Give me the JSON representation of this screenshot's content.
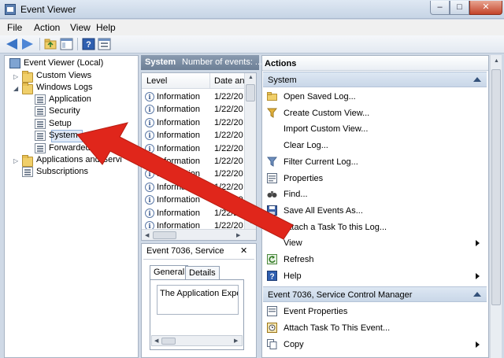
{
  "window": {
    "title": "Event Viewer",
    "controls": {
      "minimize": "–",
      "maximize": "□",
      "close": "✕"
    }
  },
  "menu": [
    "File",
    "Action",
    "View",
    "Help"
  ],
  "toolbar": {
    "icons": [
      "back-arrow-icon",
      "forward-arrow-icon",
      "folder-up-icon",
      "show-hide-tree-icon",
      "help-icon",
      "properties-icon"
    ]
  },
  "tree": {
    "root": "Event Viewer (Local)",
    "custom_views": "Custom Views",
    "windows_logs": "Windows Logs",
    "logs": [
      "Application",
      "Security",
      "Setup",
      "System",
      "Forwarded"
    ],
    "apps_services": "Applications and Servi",
    "subscriptions": "Subscriptions",
    "selected": "System"
  },
  "middle": {
    "header_title": "System",
    "header_count": "Number of events: ...",
    "columns": {
      "level": "Level",
      "date": "Date and"
    },
    "rows": [
      {
        "level": "Information",
        "date": "1/22/20"
      },
      {
        "level": "Information",
        "date": "1/22/20"
      },
      {
        "level": "Information",
        "date": "1/22/20"
      },
      {
        "level": "Information",
        "date": "1/22/20"
      },
      {
        "level": "Information",
        "date": "1/22/20"
      },
      {
        "level": "Information",
        "date": "1/22/20"
      },
      {
        "level": "Information",
        "date": "1/22/20"
      },
      {
        "level": "Information",
        "date": "1/22/20"
      },
      {
        "level": "Information",
        "date": "1/22/20"
      },
      {
        "level": "Information",
        "date": "1/22/20"
      },
      {
        "level": "Information",
        "date": "1/22/20"
      }
    ],
    "detail": {
      "title": "Event 7036, Service",
      "close": "✕",
      "tabs": [
        "General",
        "Details"
      ],
      "text": "The Application Expe"
    }
  },
  "actions": {
    "header": "Actions",
    "sections": [
      {
        "title": "System",
        "items": [
          {
            "label": "Open Saved Log...",
            "icon": "open-folder-icon"
          },
          {
            "label": "Create Custom View...",
            "icon": "filter-create-icon"
          },
          {
            "label": "Import Custom View...",
            "icon": ""
          },
          {
            "label": "Clear Log...",
            "icon": ""
          },
          {
            "label": "Filter Current Log...",
            "icon": "filter-icon"
          },
          {
            "label": "Properties",
            "icon": "properties-icon"
          },
          {
            "label": "Find...",
            "icon": "binoculars-icon"
          },
          {
            "label": "Save All Events As...",
            "icon": "save-icon"
          },
          {
            "label": "Attach a Task To this Log...",
            "icon": ""
          },
          {
            "label": "View",
            "icon": "",
            "submenu": true
          },
          {
            "label": "Refresh",
            "icon": "refresh-icon"
          },
          {
            "label": "Help",
            "icon": "help-icon",
            "submenu": true
          }
        ]
      },
      {
        "title": "Event 7036, Service Control Manager",
        "items": [
          {
            "label": "Event Properties",
            "icon": "event-properties-icon"
          },
          {
            "label": "Attach Task To This Event...",
            "icon": "task-icon"
          },
          {
            "label": "Copy",
            "icon": "copy-icon",
            "submenu": true
          }
        ]
      }
    ]
  },
  "colors": {
    "accent": "#3b75c6",
    "annotation_arrow": "#e0261b",
    "pane_header": "#7a8ca3",
    "selection": "#dfe9f7"
  }
}
